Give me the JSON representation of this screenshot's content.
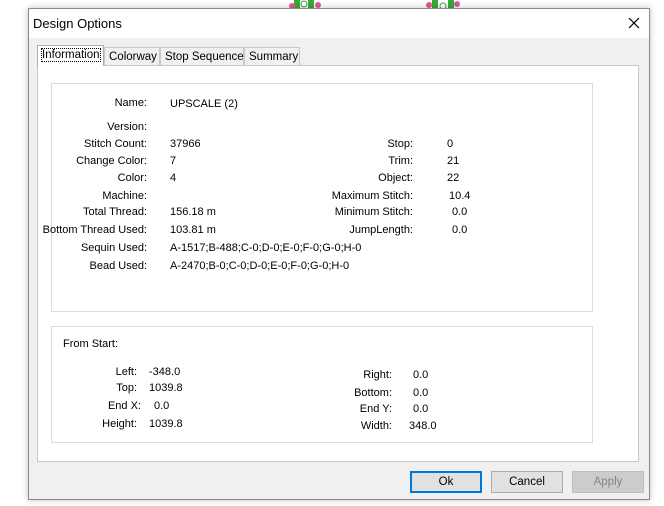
{
  "dialog": {
    "title": "Design Options"
  },
  "tabs": [
    {
      "label": "Information"
    },
    {
      "label": "Colorway"
    },
    {
      "label": "Stop Sequence"
    },
    {
      "label": "Summary"
    }
  ],
  "info": {
    "name_label": "Name:",
    "name_value": "UPSCALE (2)",
    "version_label": "Version:",
    "version_value": "",
    "stitch_count_label": "Stitch Count:",
    "stitch_count_value": "37966",
    "change_color_label": "Change Color:",
    "change_color_value": "7",
    "color_label": "Color:",
    "color_value": "4",
    "machine_label": "Machine:",
    "machine_value": "",
    "total_thread_label": "Total Thread:",
    "total_thread_value": "156.18 m",
    "bottom_thread_label": "Bottom Thread Used:",
    "bottom_thread_value": "103.81 m",
    "sequin_used_label": "Sequin Used:",
    "sequin_used_value": "A-1517;B-488;C-0;D-0;E-0;F-0;G-0;H-0",
    "bead_used_label": "Bead Used:",
    "bead_used_value": "A-2470;B-0;C-0;D-0;E-0;F-0;G-0;H-0",
    "stop_label": "Stop:",
    "stop_value": "0",
    "trim_label": "Trim:",
    "trim_value": "21",
    "object_label": "Object:",
    "object_value": "22",
    "max_stitch_label": "Maximum Stitch:",
    "max_stitch_value": "10.4",
    "min_stitch_label": "Minimum Stitch:",
    "min_stitch_value": "0.0",
    "jump_length_label": "JumpLength:",
    "jump_length_value": "0.0"
  },
  "from_start": {
    "heading": "From Start:",
    "left_label": "Left:",
    "left_value": "-348.0",
    "top_label": "Top:",
    "top_value": "1039.8",
    "end_x_label": "End X:",
    "end_x_value": "0.0",
    "height_label": "Height:",
    "height_value": "1039.8",
    "right_label": "Right:",
    "right_value": "0.0",
    "bottom_label": "Bottom:",
    "bottom_value": "0.0",
    "end_y_label": "End Y:",
    "end_y_value": "0.0",
    "width_label": "Width:",
    "width_value": "348.0"
  },
  "buttons": {
    "ok": "Ok",
    "cancel": "Cancel",
    "apply": "Apply"
  },
  "colors": {
    "accent": "#0078d7",
    "background_art_green": "#3aa83a",
    "background_art_pink": "#e05a9a"
  }
}
